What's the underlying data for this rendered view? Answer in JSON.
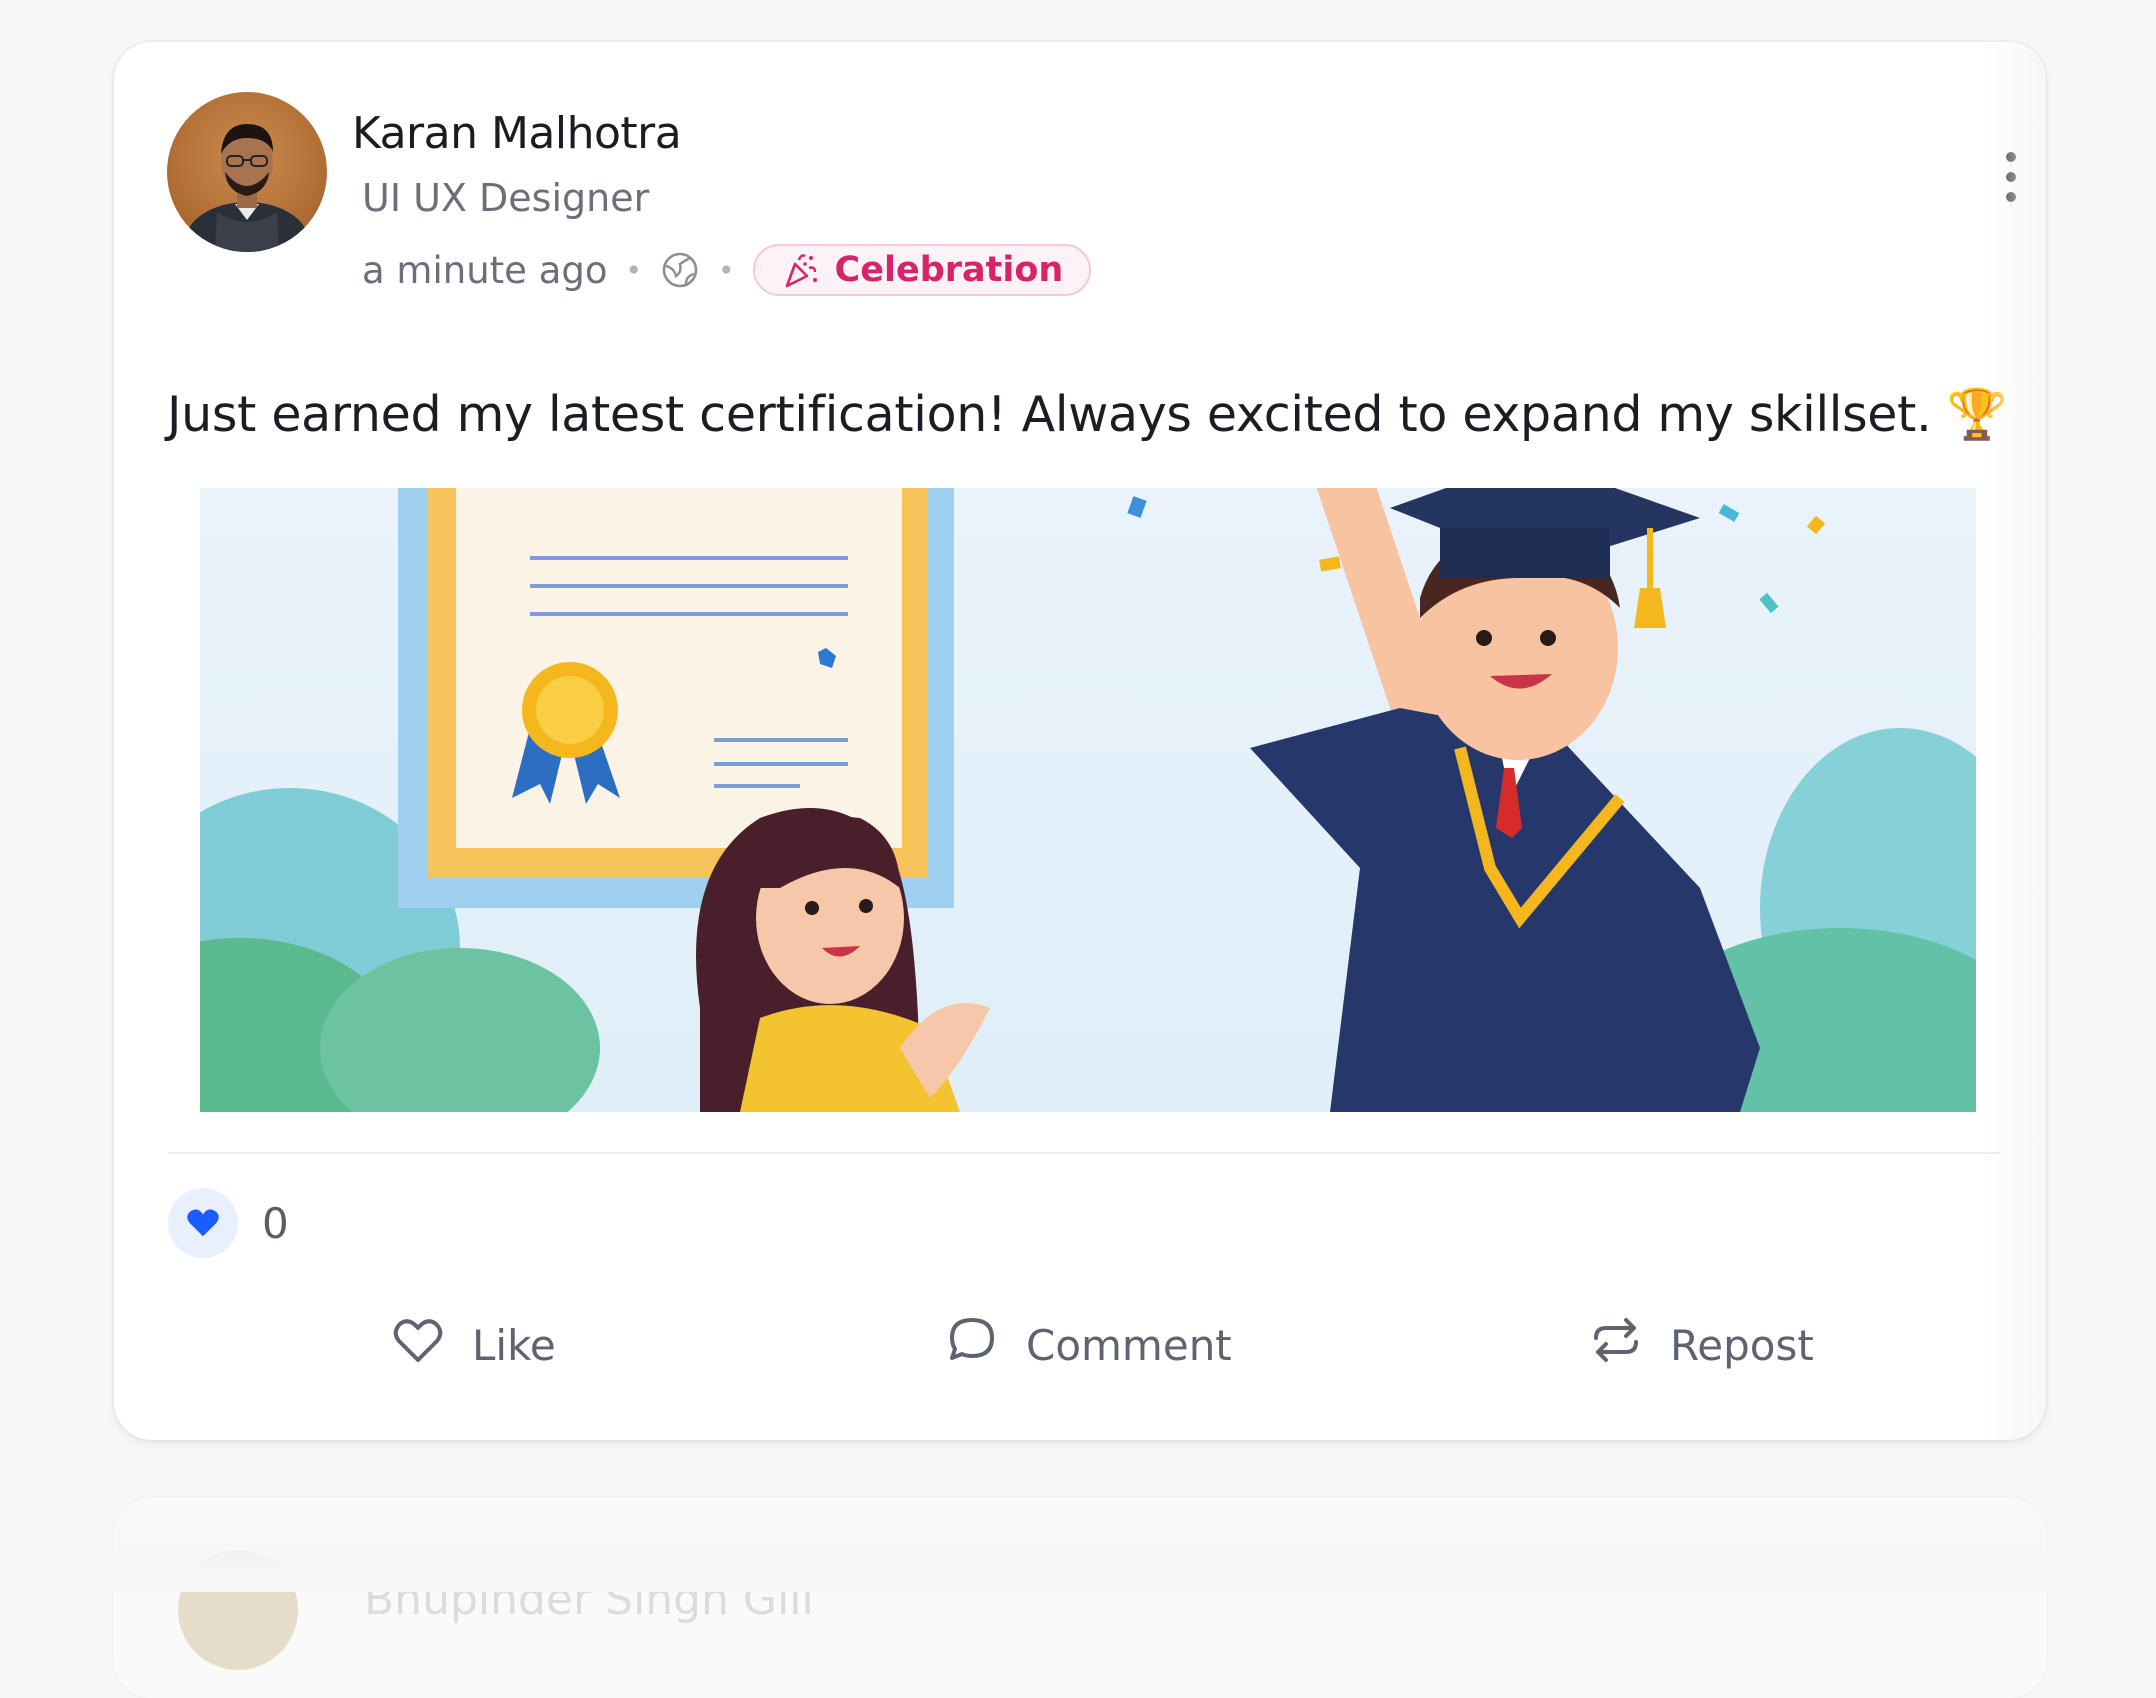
{
  "post": {
    "author_name": "Karan Malhotra",
    "author_title": "UI UX Designer",
    "timestamp": "a minute ago",
    "visibility_icon": "globe-icon",
    "badge_label": "Celebration",
    "badge_icon": "party-popper-icon",
    "text": "Just earned my latest certification! Always excited to expand my skillset. 🏆",
    "image_alt": "Illustration of a graduate celebrating with a certificate",
    "reaction_count": "0",
    "reaction_icon": "heart-icon"
  },
  "actions": {
    "like_label": "Like",
    "comment_label": "Comment",
    "repost_label": "Repost"
  },
  "next_post": {
    "author_name": "Bhupinder Singh Gill"
  },
  "colors": {
    "badge_text": "#d6246b",
    "badge_bg": "#fdf2f7",
    "reaction_heart": "#1a5cff",
    "name": "#1b1b22",
    "muted": "#6b6f7a"
  }
}
